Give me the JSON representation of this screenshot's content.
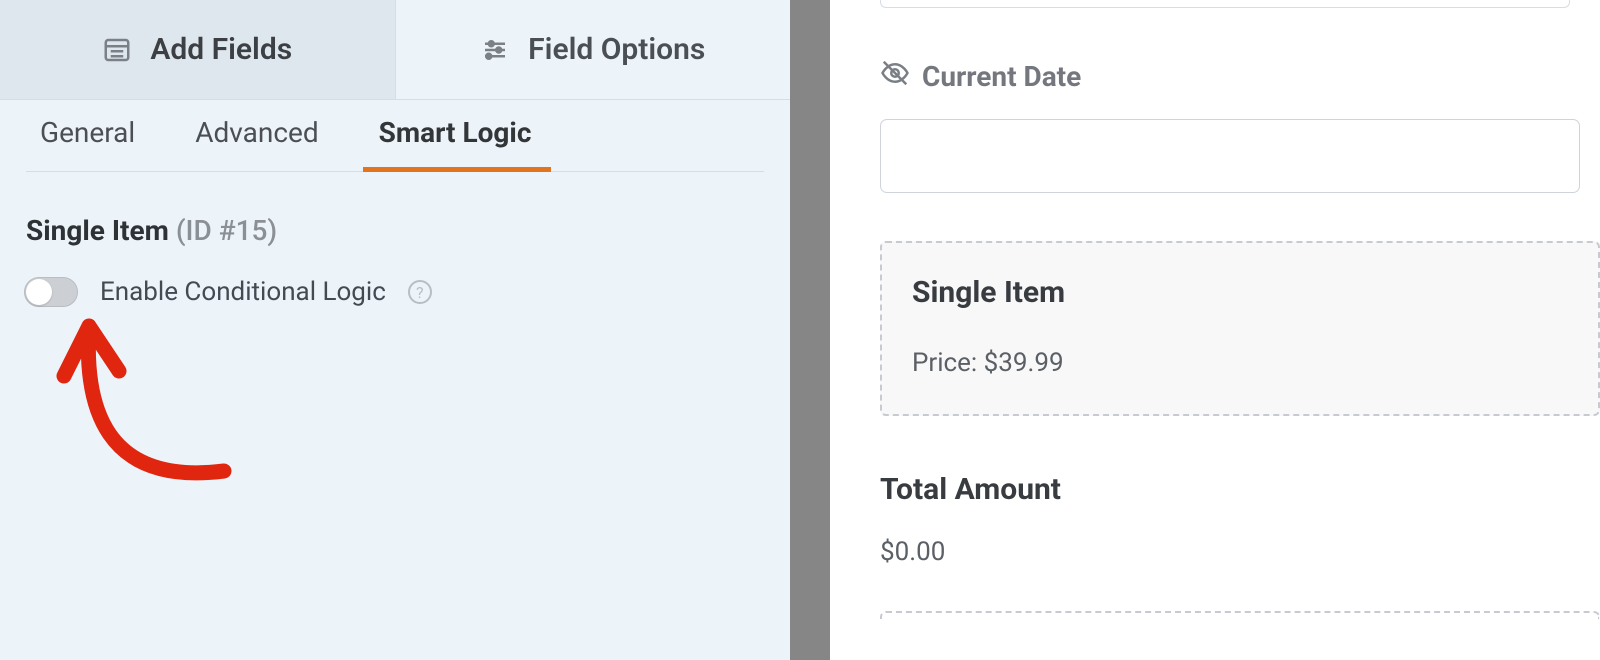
{
  "sidebar": {
    "topTabs": {
      "addFields": "Add Fields",
      "fieldOptions": "Field Options"
    },
    "subTabs": [
      "General",
      "Advanced",
      "Smart Logic"
    ],
    "activeSubTab": "Smart Logic",
    "fieldName": "Single Item",
    "fieldIdLabel": "(ID #15)",
    "toggle": {
      "label": "Enable Conditional Logic",
      "enabled": false
    }
  },
  "preview": {
    "currentDate": {
      "label": "Current Date",
      "value": ""
    },
    "singleItem": {
      "title": "Single Item",
      "priceLabel": "Price: $39.99"
    },
    "total": {
      "title": "Total Amount",
      "value": "$0.00"
    }
  }
}
